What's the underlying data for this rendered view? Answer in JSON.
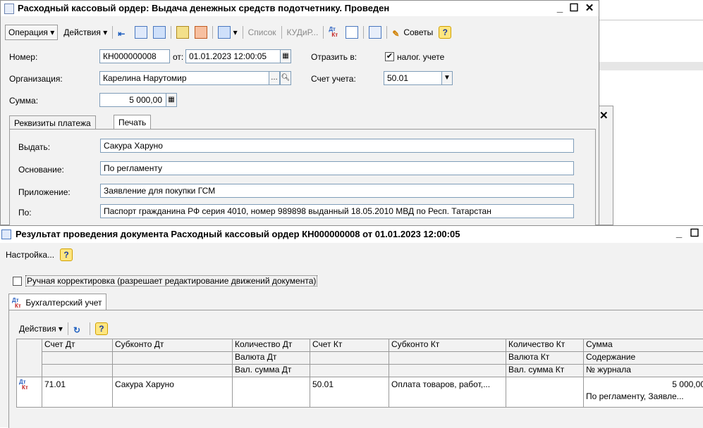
{
  "doc_window": {
    "title": "Расходный кассовый ордер: Выдача денежных средств подотчетнику. Проведен",
    "toolbar": {
      "operation": "Операция",
      "actions": "Действия",
      "list": "Список",
      "kud": "КУДиР...",
      "tips": "Советы",
      "help": "?"
    },
    "number_label": "Номер:",
    "number_value": "КН000000008",
    "from_label": "от:",
    "date_value": "01.01.2023 12:00:05",
    "reflect_label": "Отразить в:",
    "tax_label": "налог. учете",
    "org_label": "Организация:",
    "org_value": "Карелина Нарутомир",
    "account_label": "Счет учета:",
    "account_value": "50.01",
    "sum_label": "Сумма:",
    "sum_value": "5 000,00",
    "tabs": [
      "Реквизиты платежа",
      "Печать"
    ],
    "issue_label": "Выдать:",
    "issue_value": "Сакура Харуно",
    "basis_label": "Основание:",
    "basis_value": "По регламенту",
    "attachment_label": "Приложение:",
    "attachment_value": "Заявление для покупки ГСМ",
    "by_label": "По:",
    "by_value": "Паспорт гражданина РФ серия 4010, номер 989898 выданный 18.05.2010 МВД по Респ. Татарстан"
  },
  "result_window": {
    "title": "Результат проведения документа Расходный кассовый ордер КН000000008 от 01.01.2023 12:00:05",
    "settings": "Настройка...",
    "help": "?",
    "manual_label": "Ручная корректировка (разрешает редактирование движений документа)",
    "tab": "Бухгалтерский учет",
    "actions": "Действия",
    "columns": {
      "debit_account": "Счет Дт",
      "debit_subconto": "Субконто Дт",
      "debit_qty": "Количество Дт",
      "debit_currency": "Валюта Дт",
      "debit_cur_sum": "Вал. сумма Дт",
      "credit_account": "Счет Кт",
      "credit_subconto": "Субконто Кт",
      "credit_qty": "Количество Кт",
      "credit_currency": "Валюта Кт",
      "credit_cur_sum": "Вал. сумма Кт",
      "sum": "Сумма",
      "content": "Содержание",
      "journal": "№ журнала"
    },
    "row": {
      "debit_account": "71.01",
      "debit_subconto": "Сакура Харуно",
      "credit_account": "50.01",
      "credit_subconto": "Оплата товаров, работ,...",
      "sum": "5 000,00",
      "content": "По регламенту, Заявле..."
    }
  },
  "dtkt_icon_text": {
    "dt": "Дт",
    "kt": "Кт"
  }
}
